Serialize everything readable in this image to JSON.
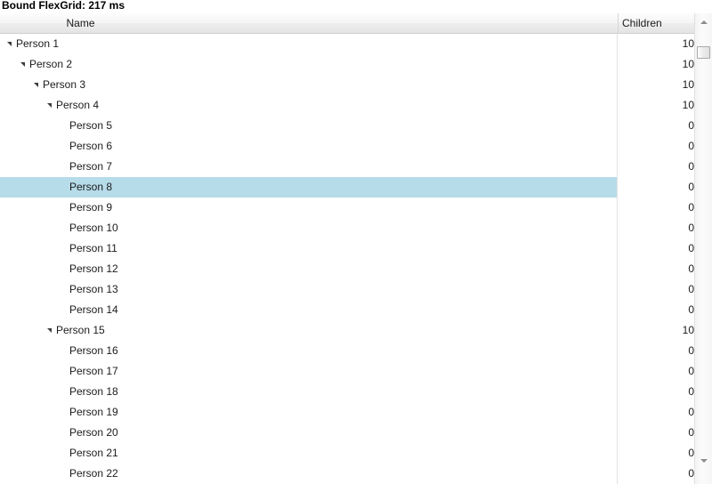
{
  "window": {
    "title": "Bound FlexGrid: 217 ms"
  },
  "grid": {
    "columns": [
      {
        "key": "name",
        "label": "Name"
      },
      {
        "key": "children",
        "label": "Children"
      }
    ],
    "rows": [
      {
        "label": "Person 1",
        "level": 0,
        "expandable": true,
        "children": "10",
        "selected": false
      },
      {
        "label": "Person 2",
        "level": 1,
        "expandable": true,
        "children": "10",
        "selected": false
      },
      {
        "label": "Person 3",
        "level": 2,
        "expandable": true,
        "children": "10",
        "selected": false
      },
      {
        "label": "Person 4",
        "level": 3,
        "expandable": true,
        "children": "10",
        "selected": false
      },
      {
        "label": "Person 5",
        "level": 4,
        "expandable": false,
        "children": "0",
        "selected": false
      },
      {
        "label": "Person 6",
        "level": 4,
        "expandable": false,
        "children": "0",
        "selected": false
      },
      {
        "label": "Person 7",
        "level": 4,
        "expandable": false,
        "children": "0",
        "selected": false
      },
      {
        "label": "Person 8",
        "level": 4,
        "expandable": false,
        "children": "0",
        "selected": true
      },
      {
        "label": "Person 9",
        "level": 4,
        "expandable": false,
        "children": "0",
        "selected": false
      },
      {
        "label": "Person 10",
        "level": 4,
        "expandable": false,
        "children": "0",
        "selected": false
      },
      {
        "label": "Person 11",
        "level": 4,
        "expandable": false,
        "children": "0",
        "selected": false
      },
      {
        "label": "Person 12",
        "level": 4,
        "expandable": false,
        "children": "0",
        "selected": false
      },
      {
        "label": "Person 13",
        "level": 4,
        "expandable": false,
        "children": "0",
        "selected": false
      },
      {
        "label": "Person 14",
        "level": 4,
        "expandable": false,
        "children": "0",
        "selected": false
      },
      {
        "label": "Person 15",
        "level": 3,
        "expandable": true,
        "children": "10",
        "selected": false
      },
      {
        "label": "Person 16",
        "level": 4,
        "expandable": false,
        "children": "0",
        "selected": false
      },
      {
        "label": "Person 17",
        "level": 4,
        "expandable": false,
        "children": "0",
        "selected": false
      },
      {
        "label": "Person 18",
        "level": 4,
        "expandable": false,
        "children": "0",
        "selected": false
      },
      {
        "label": "Person 19",
        "level": 4,
        "expandable": false,
        "children": "0",
        "selected": false
      },
      {
        "label": "Person 20",
        "level": 4,
        "expandable": false,
        "children": "0",
        "selected": false
      },
      {
        "label": "Person 21",
        "level": 4,
        "expandable": false,
        "children": "0",
        "selected": false
      },
      {
        "label": "Person 22",
        "level": 4,
        "expandable": false,
        "children": "0",
        "selected": false
      }
    ]
  },
  "scrollbar": {
    "up_icon": "arrow-up-icon",
    "down_icon": "arrow-down-icon"
  },
  "colors": {
    "selection": "#b6dbe9",
    "header_border": "#cfcfcf",
    "grid_line": "#e2e2e2",
    "text": "#1b1b1b"
  }
}
